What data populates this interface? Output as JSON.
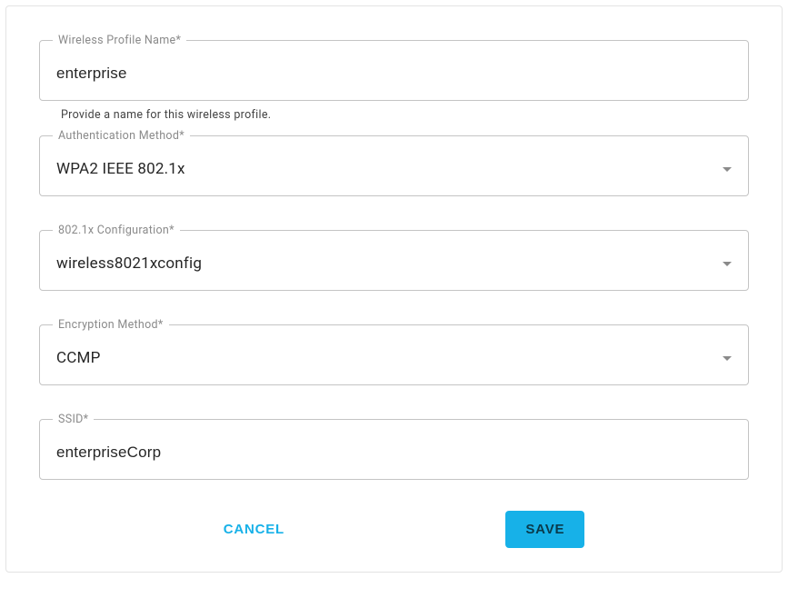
{
  "fields": {
    "profileName": {
      "label": "Wireless Profile Name*",
      "value": "enterprise",
      "hint": "Provide a name for this wireless profile."
    },
    "authMethod": {
      "label": "Authentication Method*",
      "value": "WPA2 IEEE 802.1x"
    },
    "config8021x": {
      "label": "802.1x Configuration*",
      "value": "wireless8021xconfig"
    },
    "encryption": {
      "label": "Encryption Method*",
      "value": "CCMP"
    },
    "ssid": {
      "label": "SSID*",
      "value": "enterpriseCorp"
    }
  },
  "actions": {
    "cancel": "CANCEL",
    "save": "SAVE"
  }
}
